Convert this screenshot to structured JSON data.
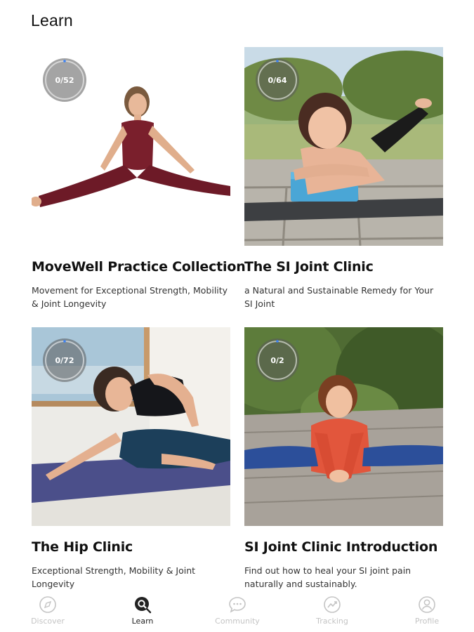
{
  "header": {
    "title": "Learn"
  },
  "cards": [
    {
      "progress_text": "0/52",
      "progress_fraction": 0.0,
      "title": "MoveWell Practice Collection",
      "description": "Movement for Exceptional Strength, Mobility & Joint Longevity"
    },
    {
      "progress_text": "0/64",
      "progress_fraction": 0.0,
      "title": "The SI Joint Clinic",
      "description": "a Natural and Sustainable Remedy for Your SI Joint"
    },
    {
      "progress_text": "0/72",
      "progress_fraction": 0.0,
      "title": "The Hip Clinic",
      "description": "Exceptional Strength, Mobility & Joint Longevity"
    },
    {
      "progress_text": "0/2",
      "progress_fraction": 0.0,
      "title": "SI Joint Clinic Introduction",
      "description": "Find out how to heal your SI joint pain naturally and sustainably."
    }
  ],
  "nav": {
    "items": [
      {
        "label": "Discover",
        "icon": "compass-icon",
        "active": false
      },
      {
        "label": "Learn",
        "icon": "learn-search-icon",
        "active": true
      },
      {
        "label": "Community",
        "icon": "chat-bubble-icon",
        "active": false
      },
      {
        "label": "Tracking",
        "icon": "trend-chart-icon",
        "active": false
      },
      {
        "label": "Profile",
        "icon": "person-icon",
        "active": false
      }
    ]
  },
  "colors": {
    "active": "#222222",
    "inactive": "#c4c4c4",
    "progress_accent": "#3b82f6"
  }
}
